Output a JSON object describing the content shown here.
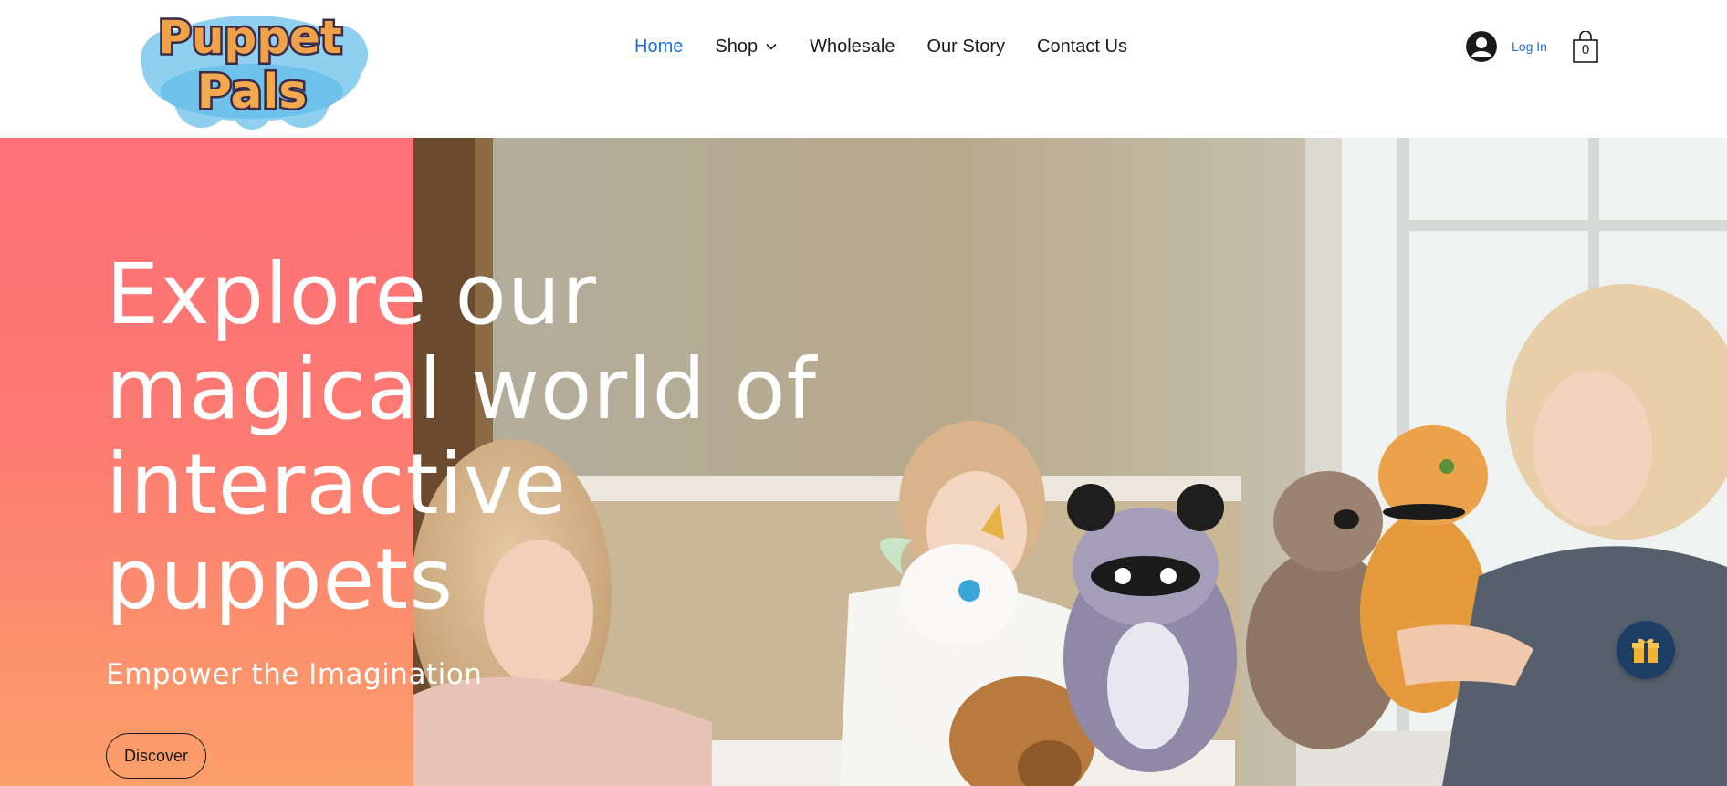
{
  "brand": {
    "logo_line1": "Puppet",
    "logo_line2": "Pals"
  },
  "nav": {
    "items": [
      {
        "label": "Home",
        "active": true
      },
      {
        "label": "Shop",
        "has_dropdown": true
      },
      {
        "label": "Wholesale"
      },
      {
        "label": "Our Story"
      },
      {
        "label": "Contact Us"
      }
    ]
  },
  "account": {
    "login_label": "Log In",
    "avatar_icon": "user-avatar-icon"
  },
  "cart": {
    "count": "0",
    "icon": "shopping-bag-icon"
  },
  "hero": {
    "headline_lines": [
      "Explore our",
      "magical world of",
      "interactive",
      "puppets"
    ],
    "subheadline": "Empower the Imagination",
    "cta_label": "Discover"
  },
  "floating": {
    "gift_icon": "gift-icon"
  },
  "colors": {
    "accent": "#1e6fd9",
    "gradient_top": "#ff6f77",
    "gradient_bottom": "#fc9f6a",
    "gift_bg": "#1d3f66",
    "gift_box": "#f3b431"
  }
}
